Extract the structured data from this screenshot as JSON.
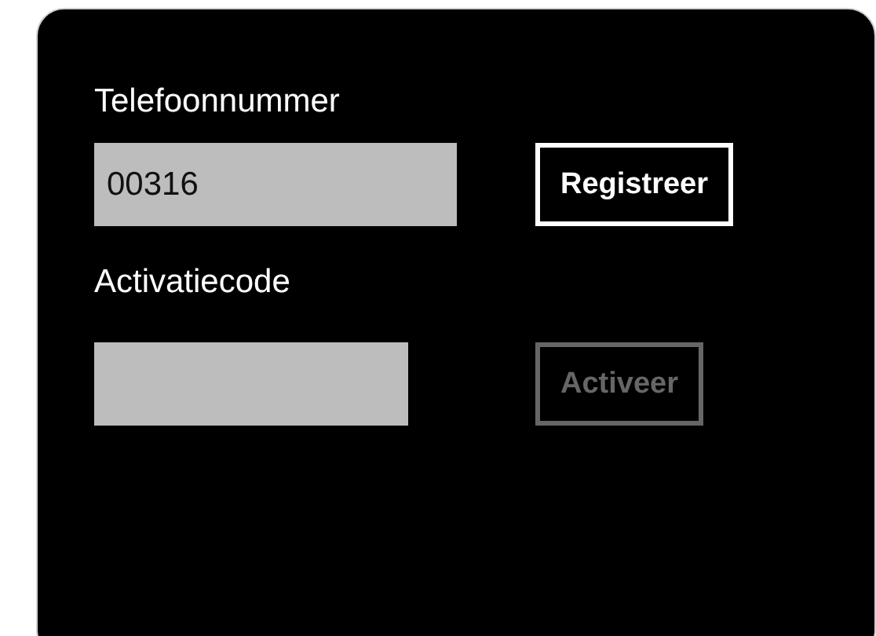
{
  "fields": [
    {
      "label": "Telefoonnummer",
      "value": "00316",
      "button": {
        "label": "Registreer",
        "disabled": false
      }
    },
    {
      "label": "Activatiecode",
      "button": {
        "label": "Activeer",
        "disabled": true
      }
    }
  ]
}
